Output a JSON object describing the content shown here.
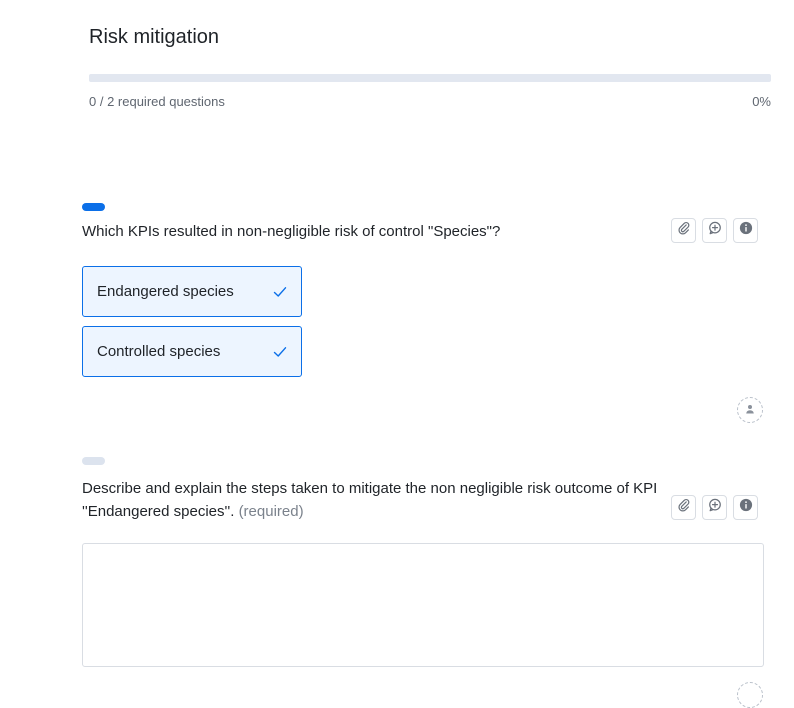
{
  "section": {
    "title": "Risk mitigation",
    "progress_label": "0 / 2 required questions",
    "progress_percent_label": "0%",
    "progress_value": 0
  },
  "questions": [
    {
      "text": "Which KPIs resulted in non-negligible risk of control \"Species\"?",
      "options": [
        {
          "label": "Endangered species",
          "selected": true
        },
        {
          "label": "Controlled species",
          "selected": true
        }
      ]
    },
    {
      "text": "Describe and explain the steps taken to mitigate the non negligible risk outcome of KPI ''Endangered species''.",
      "required_label": "(required)",
      "answer_value": ""
    }
  ],
  "icons": {
    "attach": "paperclip-icon",
    "comment": "comment-plus-icon",
    "info": "info-icon",
    "check": "check-icon",
    "assignee": "user-icon"
  },
  "colors": {
    "accent": "#0b6fe8",
    "selected_bg": "#edf5ff",
    "track": "#e2e7f0"
  }
}
